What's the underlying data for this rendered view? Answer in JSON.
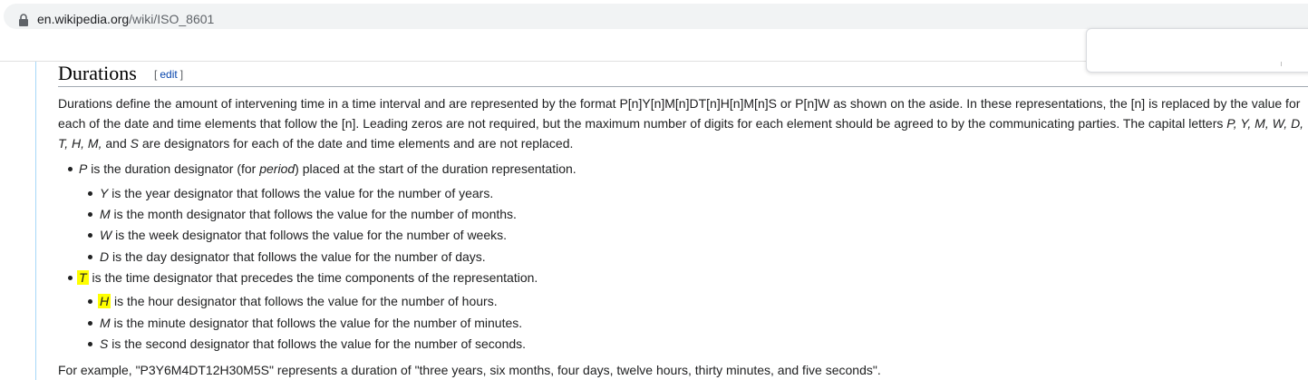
{
  "browser": {
    "url_domain": "en.wikipedia.org",
    "url_path": "/wiki/ISO_8601",
    "lock_icon": "lock-icon"
  },
  "section": {
    "title": "Durations",
    "edit_open": "[",
    "edit_label": "edit",
    "edit_close": "]"
  },
  "intro": {
    "line1": "Durations define the amount of intervening time in a time interval and are represented by the format P[n]Y[n]M[n]DT[n]H[n]M[n]S or P[n]W as shown on the aside. In these representations, the [n] is replaced by the value for",
    "line2_a": "each of the date and time elements that follow the [n]. Leading zeros are not required, but the maximum number of digits for each element should be agreed to by the communicating parties. The capital letters ",
    "line2_letters": "P, Y, M, W, D,",
    "line3_letters": "T, H, M,",
    "line3_and": " and ",
    "line3_s": "S",
    "line3_rest": " are designators for each of the date and time elements and are not replaced."
  },
  "list": {
    "p_item": {
      "letter": "P",
      "a": " is the duration designator (for ",
      "italic": "period",
      "b": ") placed at the start of the duration representation."
    },
    "y_item": {
      "letter": "Y",
      "rest": " is the year designator that follows the value for the number of years."
    },
    "m_item": {
      "letter": "M",
      "rest": " is the month designator that follows the value for the number of months."
    },
    "w_item": {
      "letter": "W",
      "rest": " is the week designator that follows the value for the number of weeks."
    },
    "d_item": {
      "letter": "D",
      "rest": " is the day designator that follows the value for the number of days."
    },
    "t_item": {
      "letter": "T",
      "rest": " is the time designator that precedes the time components of the representation."
    },
    "h_item": {
      "letter": "H",
      "rest": " is the hour designator that follows the value for the number of hours."
    },
    "min_item": {
      "letter": "M",
      "rest": " is the minute designator that follows the value for the number of minutes."
    },
    "s_item": {
      "letter": "S",
      "rest": " is the second designator that follows the value for the number of seconds."
    }
  },
  "example": {
    "text": "For example, \"P3Y6M4DT12H30M5S\" represents a duration of \"three years, six months, four days, twelve hours, thirty minutes, and five seconds\"."
  },
  "colors": {
    "highlight": "#ffff00",
    "link": "#0645ad",
    "text": "#202122"
  }
}
